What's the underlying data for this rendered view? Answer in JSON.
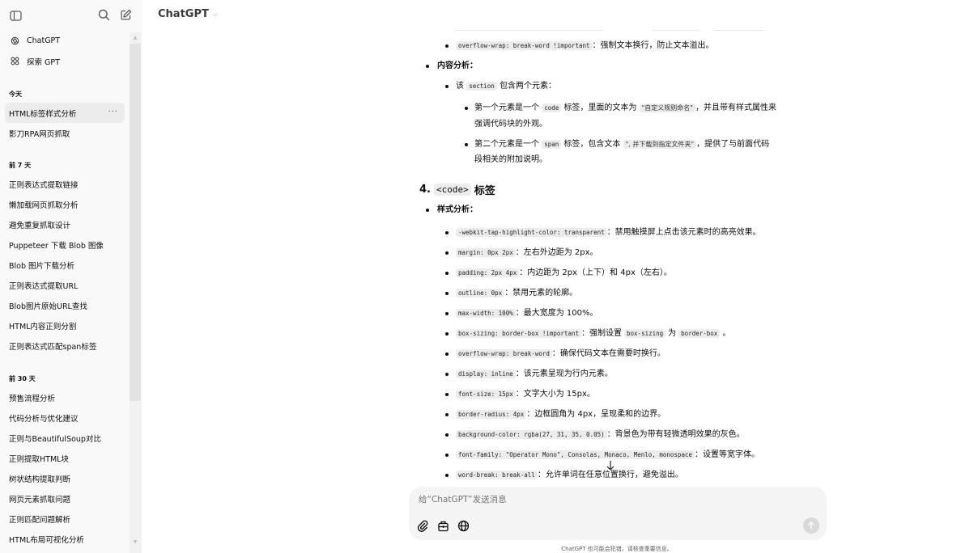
{
  "sidebar": {
    "top_items": [
      {
        "label": "ChatGPT",
        "icon": "openai-logo-icon"
      },
      {
        "label": "探索 GPT",
        "icon": "grid-icon"
      }
    ],
    "groups": [
      {
        "heading": "今天",
        "items": [
          "HTML标签样式分析",
          "影刀RPA网页抓取"
        ]
      },
      {
        "heading": "前 7 天",
        "items": [
          "正则表达式提取链接",
          "懒加载网页抓取分析",
          "避免重复抓取设计",
          "Puppeteer 下载 Blob 图像",
          "Blob 图片下载分析",
          "正则表达式提取URL",
          "Blob图片原始URL查找",
          "HTML内容正则分割",
          "正则表达式匹配span标签"
        ]
      },
      {
        "heading": "前 30 天",
        "items": [
          "预售流程分析",
          "代码分析与优化建议",
          "正则与BeautifulSoup对比",
          "正则提取HTML块",
          "树状结构提取判断",
          "网页元素抓取问题",
          "正则匹配问题解析",
          "HTML布局可视化分析"
        ]
      }
    ],
    "active_item_more": "···"
  },
  "header": {
    "title": "ChatGPT",
    "chevron": "⌵"
  },
  "content": {
    "prev_bullet": {
      "code": "overflow-wrap: break-word !important",
      "text": "：强制文本换行，防止文本溢出。"
    },
    "content_analysis_label": "内容分析：",
    "section_line": {
      "pre": "该",
      "code": "section",
      "post": "包含两个元素："
    },
    "el1": {
      "pre": "第一个元素是一个",
      "code": "code",
      "mid": "标签，里面的文本为",
      "cn_code": "\"自定义规则命名\"",
      "post": "，并且带有样式属性来",
      "cont": "强调代码块的外观。"
    },
    "el2": {
      "pre": "第二个元素是一个",
      "code": "span",
      "mid": "标签，包含文本",
      "cn_code": "\", 并下载到指定文件夹\"",
      "post": "，提供了与前面代码",
      "cont": "段相关的附加说明。"
    },
    "h4": {
      "num": "4.",
      "code": "<code>",
      "text": "标签"
    },
    "style_analysis_label": "样式分析：",
    "styles": [
      {
        "code": "-webkit-tap-highlight-color: transparent",
        "text": "：禁用触摸屏上点击该元素时的高亮效果。"
      },
      {
        "code": "margin: 0px 2px",
        "text": "：左右外边距为 2px。"
      },
      {
        "code": "padding: 2px 4px",
        "text": "：内边距为 2px（上下）和 4px（左右）。"
      },
      {
        "code": "outline: 0px",
        "text": "：禁用元素的轮廓。"
      },
      {
        "code": "max-width: 100%",
        "text": "：最大宽度为 100%。"
      },
      {
        "code": "box-sizing: border-box !important",
        "text": "：强制设置",
        "code2": "box-sizing",
        "text2": "为",
        "code3": "border-box",
        "text3": "。"
      },
      {
        "code": "overflow-wrap: break-word",
        "text": "：确保代码文本在需要时换行。"
      },
      {
        "code": "display: inline",
        "text": "：该元素呈现为行内元素。"
      },
      {
        "code": "font-size: 15px",
        "text": "：文字大小为 15px。"
      },
      {
        "code": "border-radius: 4px",
        "text": "：边框圆角为 4px，呈现柔和的边界。"
      },
      {
        "code": "background-color: rgba(27, 31, 35, 0.05)",
        "text": "：背景色为带有轻微透明效果的灰色。"
      },
      {
        "code": "font-family: \"Operator Mono\", Consolas, Monaco, Menlo, monospace",
        "text": "：设置等宽字体。"
      },
      {
        "code": "word-break: break-all",
        "text": "：允许单词在任意位置换行，避免溢出。"
      }
    ]
  },
  "composer": {
    "placeholder": "给“ChatGPT”发送消息"
  },
  "footer": {
    "note": "ChatGPT 也可能会犯错。请核查重要信息。"
  }
}
